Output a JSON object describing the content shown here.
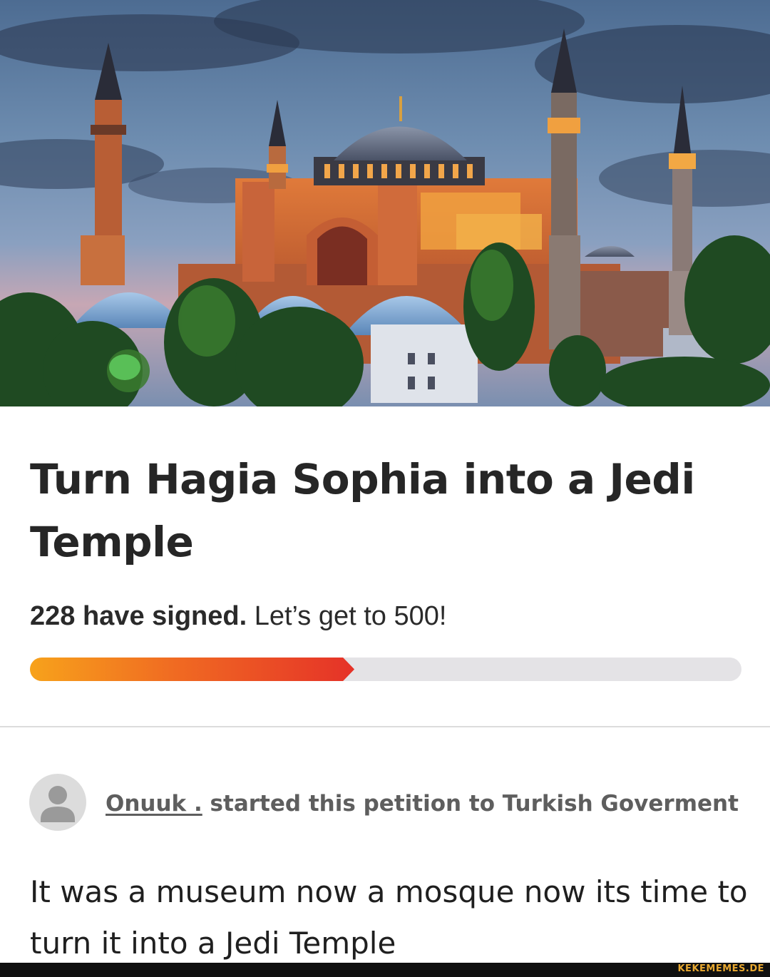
{
  "hero": {
    "image_subject": "Hagia Sophia at dusk"
  },
  "petition": {
    "title": "Turn Hagia Sophia into a Jedi Temple",
    "signed_count_text": "228 have signed.",
    "goal_text": " Let’s get to 500!",
    "progress_fraction": 0.456,
    "progress_colors": {
      "start": "#f7a21b",
      "end": "#e53228",
      "track": "#e4e3e6"
    }
  },
  "starter": {
    "name": "Onuuk .",
    "text": " started this petition to Turkish Goverment"
  },
  "description": "It was a museum now a mosque now its time to turn it into a Jedi Temple",
  "watermark": {
    "text": "KEKEMEMES.DE",
    "color": "#e8a830"
  },
  "icons": {
    "avatar": "user-silhouette-icon"
  }
}
